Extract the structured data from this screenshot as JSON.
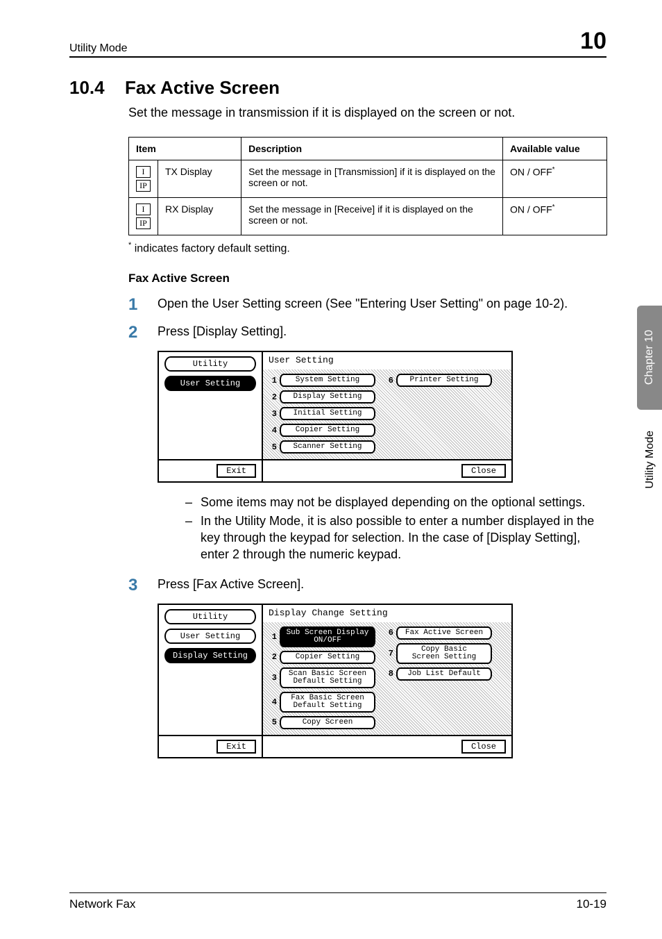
{
  "running_head": {
    "title": "Utility Mode",
    "chapter_num": "10"
  },
  "section": {
    "number": "10.4",
    "title": "Fax Active Screen"
  },
  "intro": "Set the message in transmission if it is displayed on the screen or not.",
  "table": {
    "headers": {
      "item": "Item",
      "desc": "Description",
      "avail": "Available value"
    },
    "rows": [
      {
        "badges": [
          "I",
          "IP"
        ],
        "name": "TX Display",
        "desc": "Set the message in [Transmission] if it is displayed on the screen or not.",
        "avail": "ON / OFF",
        "avail_mark": "*"
      },
      {
        "badges": [
          "I",
          "IP"
        ],
        "name": "RX Display",
        "desc": "Set the message in [Receive] if it is displayed on the screen or not.",
        "avail": "ON / OFF",
        "avail_mark": "*"
      }
    ]
  },
  "footnote": {
    "mark": "*",
    "text": " indicates factory default setting."
  },
  "subhead": "Fax Active Screen",
  "steps": [
    {
      "n": "1",
      "text": "Open the User Setting screen (See \"Entering User Setting\" on page 10-2)."
    },
    {
      "n": "2",
      "text": "Press [Display Setting]."
    },
    {
      "n": "3",
      "text": "Press [Fax Active Screen]."
    }
  ],
  "panel1": {
    "crumbs": [
      "Utility",
      "User Setting"
    ],
    "active_crumb": 1,
    "title": "User Setting",
    "left_col": [
      {
        "n": "1",
        "label": "System Setting"
      },
      {
        "n": "2",
        "label": "Display Setting"
      },
      {
        "n": "3",
        "label": "Initial Setting"
      },
      {
        "n": "4",
        "label": "Copier Setting"
      },
      {
        "n": "5",
        "label": "Scanner Setting"
      }
    ],
    "right_col": [
      {
        "n": "6",
        "label": "Printer Setting"
      }
    ],
    "exit": "Exit",
    "close": "Close"
  },
  "notes": [
    "Some items may not be displayed depending on the optional settings.",
    "In the Utility Mode, it is also possible to enter a number displayed in the key through the keypad for selection. In the case of [Display Setting], enter 2 through the numeric keypad."
  ],
  "panel2": {
    "crumbs": [
      "Utility",
      "User Setting",
      "Display Setting"
    ],
    "active_crumb": 2,
    "title": "Display Change Setting",
    "left_col": [
      {
        "n": "1",
        "label": "Sub Screen Display\nON/OFF",
        "sel": true
      },
      {
        "n": "2",
        "label": "Copier Setting"
      },
      {
        "n": "3",
        "label": "Scan Basic Screen\nDefault Setting"
      },
      {
        "n": "4",
        "label": "Fax Basic Screen\nDefault Setting"
      },
      {
        "n": "5",
        "label": "Copy Screen"
      }
    ],
    "right_col": [
      {
        "n": "6",
        "label": "Fax Active Screen"
      },
      {
        "n": "7",
        "label": "Copy Basic\nScreen Setting"
      },
      {
        "n": "8",
        "label": "Job List Default"
      }
    ],
    "exit": "Exit",
    "close": "Close"
  },
  "side": {
    "chapter": "Chapter 10",
    "mode": "Utility Mode"
  },
  "footer": {
    "left": "Network Fax",
    "right": "10-19"
  }
}
